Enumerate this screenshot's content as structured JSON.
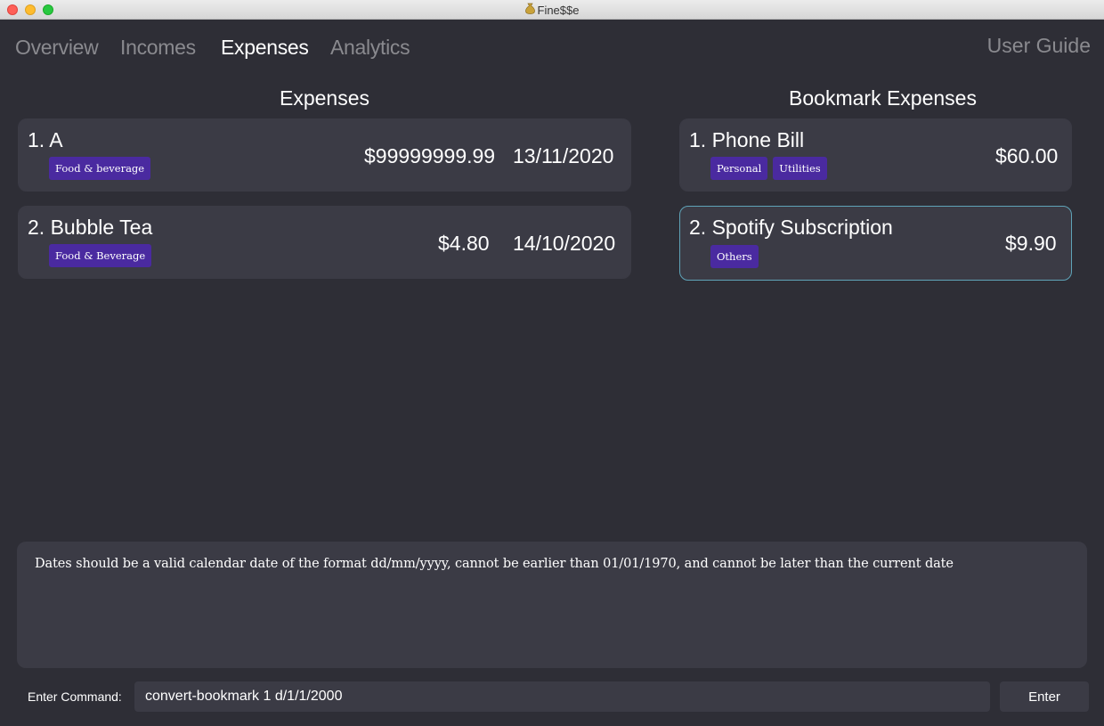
{
  "window": {
    "title": "Fine$$e"
  },
  "nav": {
    "tabs": [
      {
        "label": "Overview"
      },
      {
        "label": "Incomes"
      },
      {
        "label": "Expenses"
      },
      {
        "label": "Analytics"
      }
    ],
    "active_tab": "Expenses",
    "user_guide": "User Guide"
  },
  "expenses": {
    "title": "Expenses",
    "items": [
      {
        "title": "1. A",
        "tags": [
          "Food & beverage"
        ],
        "amount": "$99999999.99",
        "date": "13/11/2020"
      },
      {
        "title": "2. Bubble Tea",
        "tags": [
          "Food & Beverage"
        ],
        "amount": "$4.80",
        "date": "14/10/2020"
      }
    ]
  },
  "bookmarks": {
    "title": "Bookmark Expenses",
    "items": [
      {
        "title": "1. Phone Bill",
        "tags": [
          "Personal",
          "Utilities"
        ],
        "amount": "$60.00"
      },
      {
        "title": "2. Spotify Subscription",
        "tags": [
          "Others"
        ],
        "amount": "$9.90",
        "selected": true
      }
    ]
  },
  "result": {
    "text": "Dates should be a valid calendar date of the format dd/mm/yyyy, cannot be earlier than 01/01/1970, and cannot be later than the current date"
  },
  "command": {
    "label": "Enter Command:",
    "value": "convert-bookmark 1 d/1/1/2000",
    "button": "Enter"
  },
  "colors": {
    "background": "#2e2e36",
    "card": "#3b3b45",
    "tag": "#4a2aa0",
    "selected_border": "#5fa3b8"
  }
}
